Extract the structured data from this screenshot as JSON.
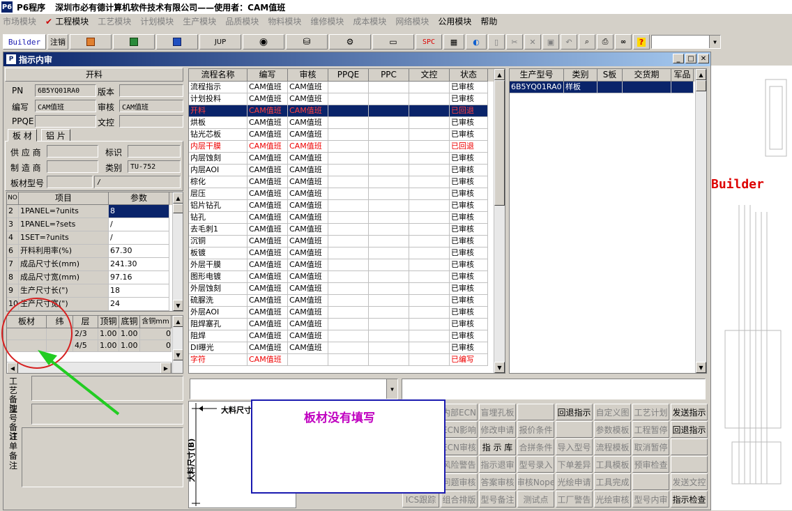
{
  "app": {
    "icon": "P6",
    "title": "P6程序",
    "company": "深圳市必有德计算机软件技术有限公司——使用者：CAM值班"
  },
  "menu": [
    {
      "label": "市场模块",
      "disabled": true
    },
    {
      "label": "工程模块",
      "disabled": false,
      "checked": true
    },
    {
      "label": "工艺模块",
      "disabled": true
    },
    {
      "label": "计划模块",
      "disabled": true
    },
    {
      "label": "生产模块",
      "disabled": true
    },
    {
      "label": "品质模块",
      "disabled": true
    },
    {
      "label": "物料模块",
      "disabled": true
    },
    {
      "label": "维修模块",
      "disabled": true
    },
    {
      "label": "成本模块",
      "disabled": true
    },
    {
      "label": "网络模块",
      "disabled": true
    },
    {
      "label": "公用模块",
      "disabled": false
    },
    {
      "label": "帮助",
      "disabled": false
    }
  ],
  "toolbar": {
    "builder": "Builder",
    "logout": "注销",
    "jup": "JUP",
    "spc": "SPC"
  },
  "window": {
    "title": "指示内审"
  },
  "left": {
    "section_title": "开料",
    "pn_label": "PN",
    "pn_value": "6B5YQ01RA0",
    "version_label": "版本",
    "version_value": "",
    "author_label": "编写",
    "author_value": "CAM值班",
    "review_label": "审核",
    "review_value": "CAM值班",
    "ppqe_label": "PPQE",
    "ppqe_value": "",
    "doc_label": "文控",
    "doc_value": "",
    "tabs": [
      "板 材",
      "铝 片"
    ],
    "supplier_label": "供 应 商",
    "supplier_value": "",
    "mark_label": "标识",
    "mark_value": "",
    "maker_label": "制 造 商",
    "maker_value": "",
    "category_label": "类别",
    "category_value": "TU-752",
    "model_label": "板材型号",
    "model_value": "",
    "model_value2": "/",
    "param_headers": [
      "NO",
      "项目",
      "参数"
    ],
    "params": [
      {
        "no": "2",
        "item": "1PANEL=?units",
        "value": "8"
      },
      {
        "no": "3",
        "item": "1PANEL=?sets",
        "value": "/"
      },
      {
        "no": "4",
        "item": "1SET=?units",
        "value": "/"
      },
      {
        "no": "6",
        "item": "开料利用率(%)",
        "value": "67.30"
      },
      {
        "no": "7",
        "item": "成品尺寸长(mm)",
        "value": "241.30"
      },
      {
        "no": "8",
        "item": "成品尺寸宽(mm)",
        "value": "97.16"
      },
      {
        "no": "9",
        "item": "生产尺寸长(\")",
        "value": "18"
      },
      {
        "no": "10",
        "item": "生产尺寸宽(\")",
        "value": "24"
      }
    ],
    "mat_headers": [
      "板材",
      "纬",
      "层",
      "顶铜",
      "底铜",
      "含铜mm"
    ],
    "mat_rows": [
      {
        "layer": "2/3",
        "top": "1.00",
        "bot": "1.00",
        "cu": "0"
      },
      {
        "layer": "4/5",
        "top": "1.00",
        "bot": "1.00",
        "cu": "0"
      }
    ],
    "craft_note_label": "工艺备注",
    "model_note_label": "型号备注",
    "order_note_label": "订单备注"
  },
  "flow": {
    "headers": [
      "流程名称",
      "编写",
      "审核",
      "PPQE",
      "PPC",
      "文控",
      "状态"
    ],
    "rows": [
      {
        "name": "流程指示",
        "author": "CAM值班",
        "review": "CAM值班",
        "status": "已审核"
      },
      {
        "name": "计划投料",
        "author": "CAM值班",
        "review": "CAM值班",
        "status": "已审核"
      },
      {
        "name": "开料",
        "author": "CAM值班",
        "review": "CAM值班",
        "status": "已回退",
        "red": true,
        "selected": true
      },
      {
        "name": "烘板",
        "author": "CAM值班",
        "review": "CAM值班",
        "status": "已审核"
      },
      {
        "name": "钻光芯板",
        "author": "CAM值班",
        "review": "CAM值班",
        "status": "已审核"
      },
      {
        "name": "内层干膜",
        "author": "CAM值班",
        "review": "CAM值班",
        "status": "已回退",
        "red": true
      },
      {
        "name": "内层蚀刻",
        "author": "CAM值班",
        "review": "CAM值班",
        "status": "已审核"
      },
      {
        "name": "内层AOI",
        "author": "CAM值班",
        "review": "CAM值班",
        "status": "已审核"
      },
      {
        "name": "棕化",
        "author": "CAM值班",
        "review": "CAM值班",
        "status": "已审核"
      },
      {
        "name": "层压",
        "author": "CAM值班",
        "review": "CAM值班",
        "status": "已审核"
      },
      {
        "name": "铝片钻孔",
        "author": "CAM值班",
        "review": "CAM值班",
        "status": "已审核"
      },
      {
        "name": "钻孔",
        "author": "CAM值班",
        "review": "CAM值班",
        "status": "已审核"
      },
      {
        "name": "去毛刺1",
        "author": "CAM值班",
        "review": "CAM值班",
        "status": "已审核"
      },
      {
        "name": "沉铜",
        "author": "CAM值班",
        "review": "CAM值班",
        "status": "已审核"
      },
      {
        "name": "板镀",
        "author": "CAM值班",
        "review": "CAM值班",
        "status": "已审核"
      },
      {
        "name": "外层干膜",
        "author": "CAM值班",
        "review": "CAM值班",
        "status": "已审核"
      },
      {
        "name": "图形电镀",
        "author": "CAM值班",
        "review": "CAM值班",
        "status": "已审核"
      },
      {
        "name": "外层蚀刻",
        "author": "CAM值班",
        "review": "CAM值班",
        "status": "已审核"
      },
      {
        "name": "硫脲洗",
        "author": "CAM值班",
        "review": "CAM值班",
        "status": "已审核"
      },
      {
        "name": "外层AOI",
        "author": "CAM值班",
        "review": "CAM值班",
        "status": "已审核"
      },
      {
        "name": "阻焊塞孔",
        "author": "CAM值班",
        "review": "CAM值班",
        "status": "已审核"
      },
      {
        "name": "阻焊",
        "author": "CAM值班",
        "review": "CAM值班",
        "status": "已审核"
      },
      {
        "name": "DI曝光",
        "author": "CAM值班",
        "review": "CAM值班",
        "status": "已审核"
      },
      {
        "name": "字符",
        "author": "CAM值班",
        "review": "",
        "status": "已编写",
        "red": true
      }
    ]
  },
  "prod": {
    "headers": [
      "生产型号",
      "类别",
      "S板",
      "交货期",
      "军品"
    ],
    "rows": [
      {
        "model": "6B5YQ01RA0",
        "type": "样板"
      }
    ]
  },
  "drawing": {
    "label_top": "大料尺寸",
    "label_side": "大料尺寸(B)"
  },
  "popup": {
    "text": "板材没有填写"
  },
  "buttons": [
    [
      "内部ECN",
      "盲埋孔板",
      "",
      "回退指示",
      "自定义图",
      "工艺计划",
      "发送指示"
    ],
    [
      "ECN影响",
      "修改申请",
      "报价条件",
      "",
      "参数模板",
      "工程暂停",
      "回退指示"
    ],
    [
      "ECN审核",
      "指 示 库",
      "合拼条件",
      "导入型号",
      "流程模板",
      "取消暂停",
      ""
    ],
    [
      "风险警告",
      "指示退审",
      "型号录入",
      "下单差异",
      "工具模板",
      "预审检查",
      ""
    ],
    [
      "问题审核",
      "答案审核",
      "审核Nope",
      "光绘申请",
      "工具完成",
      "",
      "发送文控"
    ],
    [
      "ICS跟踪",
      "组合排版",
      "型号备注",
      "测试点",
      "工厂警告",
      "光绘审核",
      "型号内审",
      "指示检查"
    ]
  ],
  "colors": {
    "accent": "#0a246a",
    "alert": "#e00000",
    "annotation_circle": "#d62020",
    "annotation_arrow": "#22cc22",
    "popup_border": "#1a1ab0",
    "popup_text": "#c000c0"
  }
}
